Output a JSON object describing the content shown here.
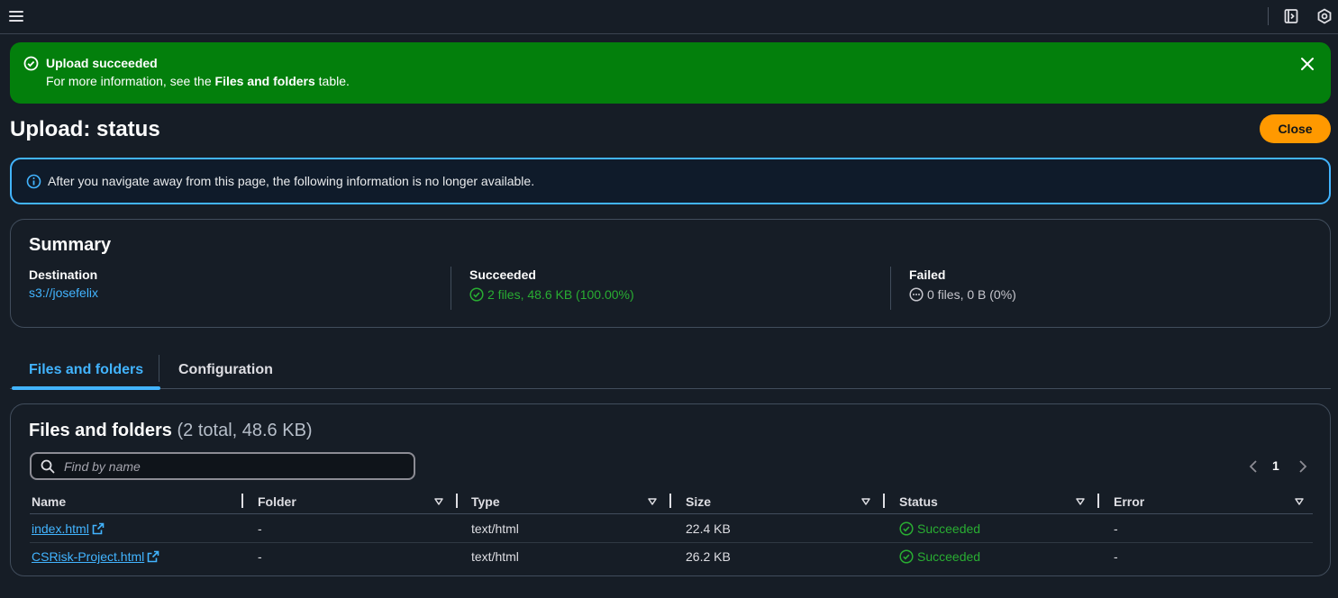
{
  "topbar": {
    "menu_icon": "hamburger-menu-icon",
    "panel_icon": "side-panel-icon",
    "settings_icon": "hexagon-settings-icon"
  },
  "flash": {
    "title": "Upload succeeded",
    "body_prefix": "For more information, see the ",
    "body_bold": "Files and folders",
    "body_suffix": " table.",
    "color": "#037f0c"
  },
  "page": {
    "title": "Upload: status",
    "close_label": "Close",
    "accent": "#ff9900"
  },
  "info": {
    "text": "After you navigate away from this page, the following information is no longer available."
  },
  "summary": {
    "title": "Summary",
    "destination_label": "Destination",
    "destination_value": "s3://josefelix",
    "succeeded_label": "Succeeded",
    "succeeded_value": "2 files, 48.6 KB (100.00%)",
    "failed_label": "Failed",
    "failed_value": "0 files, 0 B (0%)"
  },
  "tabs": [
    {
      "label": "Files and folders",
      "active": true
    },
    {
      "label": "Configuration",
      "active": false
    }
  ],
  "files": {
    "heading": "Files and folders",
    "count": "(2 total, 48.6 KB)",
    "search_placeholder": "Find by name",
    "page_number": "1",
    "columns": [
      "Name",
      "Folder",
      "Type",
      "Size",
      "Status",
      "Error"
    ],
    "rows": [
      {
        "name": "index.html",
        "folder": "-",
        "type": "text/html",
        "size": "22.4 KB",
        "status": "Succeeded",
        "error": "-"
      },
      {
        "name": "CSRisk-Project.html",
        "folder": "-",
        "type": "text/html",
        "size": "26.2 KB",
        "status": "Succeeded",
        "error": "-"
      }
    ]
  }
}
